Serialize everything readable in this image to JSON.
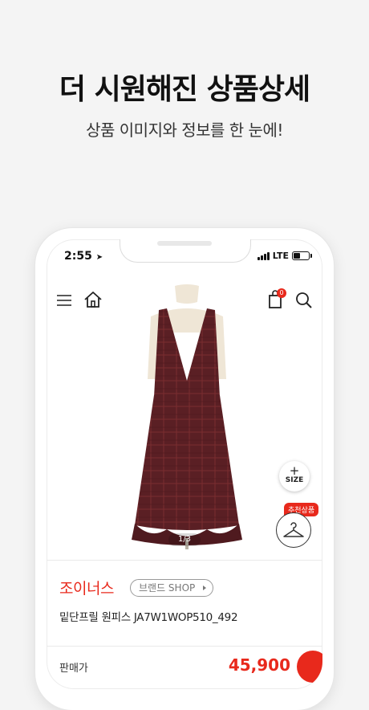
{
  "promo": {
    "headline": "더 시원해진 상품상세",
    "subline": "상품 이미지와 정보를 한 눈에!"
  },
  "status_bar": {
    "time": "2:55",
    "network": "LTE"
  },
  "gallery": {
    "page_indicator": "1/3",
    "size_button_label": "SIZE",
    "recommend_tag": "추천상품"
  },
  "cart": {
    "count": "0"
  },
  "product": {
    "brand": "조이너스",
    "brand_shop_label": "브랜드 SHOP",
    "name": "밑단프릴 원피스 JA7W1WOP510_492",
    "price_label": "판매가",
    "price": "45,900"
  },
  "colors": {
    "accent": "#e8291c",
    "dress": "#5a1f24",
    "blouse": "#efe6d6"
  }
}
